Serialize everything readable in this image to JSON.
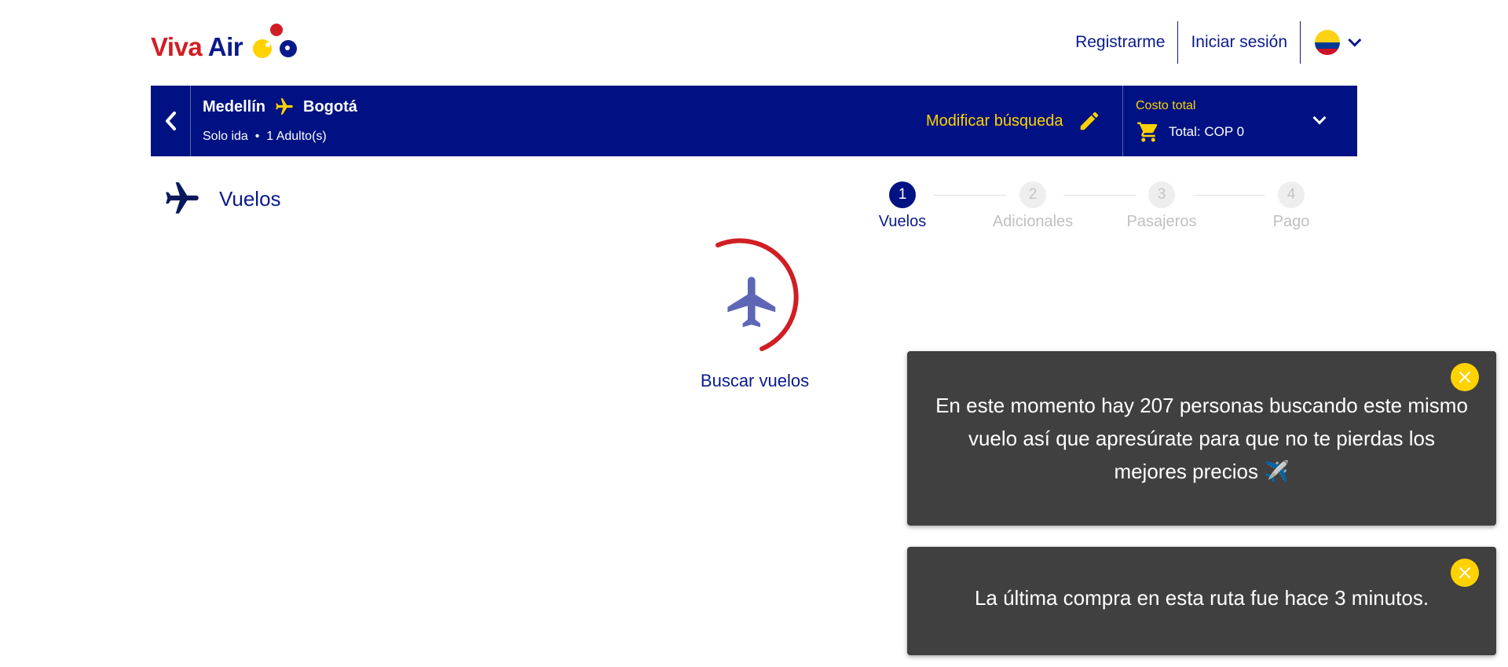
{
  "header": {
    "logo": {
      "text_viva": "Viva",
      "text_air": "Air"
    },
    "nav": {
      "register": "Registrarme",
      "login": "Iniciar sesión"
    },
    "language": {
      "flag_icon": "colombia-flag-icon",
      "chevron_icon": "chevron-down-icon"
    }
  },
  "search": {
    "origin": "Medellín",
    "destination": "Bogotá",
    "trip_type": "Solo ida",
    "passengers": "1 Adulto(s)",
    "modify_label": "Modificar búsqueda",
    "total_label": "Costo total",
    "total_value": "Total: COP 0"
  },
  "section": {
    "title": "Vuelos"
  },
  "steps": [
    {
      "number": "1",
      "label": "Vuelos",
      "active": true
    },
    {
      "number": "2",
      "label": "Adicionales",
      "active": false
    },
    {
      "number": "3",
      "label": "Pasajeros",
      "active": false
    },
    {
      "number": "4",
      "label": "Pago",
      "active": false
    }
  ],
  "loader": {
    "label": "Buscar vuelos"
  },
  "toasts": [
    {
      "text": "En este momento hay 207 personas buscando este mismo vuelo así que apresúrate para que no te pierdas los mejores precios ✈️"
    },
    {
      "text": "La última compra en esta ruta fue hace 3 minutos."
    }
  ],
  "colors": {
    "brand_blue": "#001283",
    "brand_yellow": "#ffd200",
    "brand_red": "#d01e24",
    "toast_bg": "#404040"
  }
}
